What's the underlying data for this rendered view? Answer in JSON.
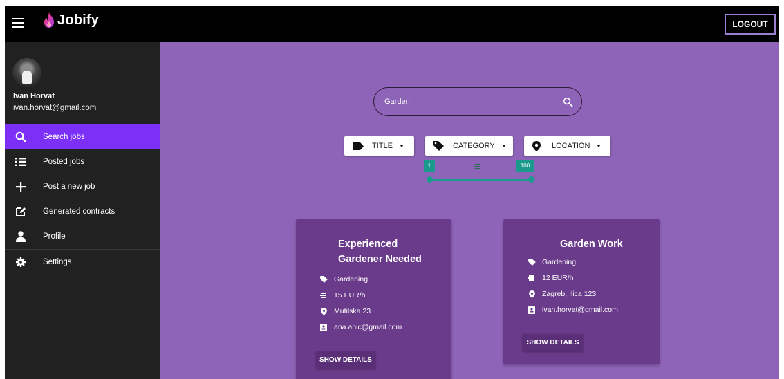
{
  "app": {
    "name": "Jobify"
  },
  "header": {
    "logout_label": "LOGOUT"
  },
  "user": {
    "name": "Ivan Horvat",
    "email": "ivan.horvat@gmail.com"
  },
  "sidebar": {
    "items": [
      {
        "label": "Search jobs",
        "icon": "search-icon",
        "active": true
      },
      {
        "label": "Posted jobs",
        "icon": "list-icon"
      },
      {
        "label": "Post a new job",
        "icon": "plus-icon"
      },
      {
        "label": "Generated contracts",
        "icon": "edit-icon"
      },
      {
        "label": "Profile",
        "icon": "person-icon"
      },
      {
        "label": "Settings",
        "icon": "gear-icon"
      }
    ]
  },
  "search": {
    "value": "Garden"
  },
  "filters": [
    {
      "label": "TITLE",
      "icon": "label-icon"
    },
    {
      "label": "CATEGORY",
      "icon": "tag-icon"
    },
    {
      "label": "LOCATION",
      "icon": "location-pin-icon"
    }
  ],
  "price_range": {
    "min": "1",
    "max": "100",
    "icon": "money-icon"
  },
  "jobs": [
    {
      "title_line1": "Experienced",
      "title_line2": "Gardener Needed",
      "category": "Gardening",
      "rate": "15 EUR/h",
      "address": "Mutilska 23",
      "contact": "ana.anic@gmail.com",
      "button": "SHOW DETAILS"
    },
    {
      "title": "Garden Work",
      "category": "Gardening",
      "rate": "12 EUR/h",
      "address": "Zagreb, Ilica 123",
      "contact": "ivan.horvat@gmail.com",
      "button": "SHOW DETAILS"
    }
  ],
  "colors": {
    "accent": "#7b2ff7",
    "main_bg": "#8e64b8",
    "card_bg": "#6a3b8a",
    "slider": "#1a9a8c"
  }
}
